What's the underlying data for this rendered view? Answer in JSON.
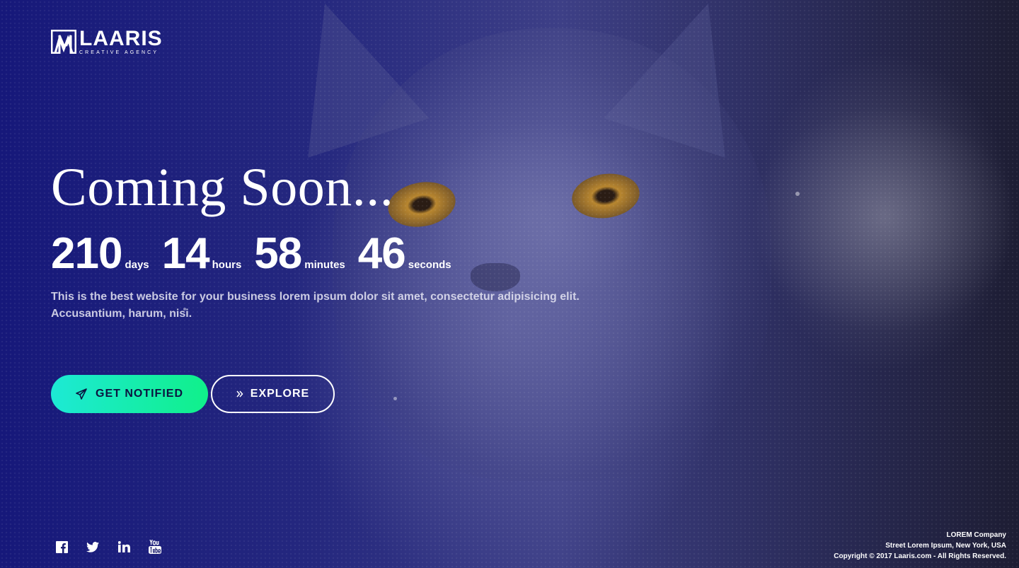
{
  "brand": {
    "name": "LAARIS",
    "tagline": "CREATIVE AGENCY",
    "accent_start": "#1de9d5",
    "accent_end": "#10f08a"
  },
  "hero": {
    "title": "Coming Soon...",
    "description_line1": "This is the best website for your business lorem ipsum dolor sit amet, consectetur adipisicing elit.",
    "description_line2": "Accusantium, harum, nisi."
  },
  "countdown": [
    {
      "value": "210",
      "label": "days"
    },
    {
      "value": "14",
      "label": "hours"
    },
    {
      "value": "58",
      "label": "minutes"
    },
    {
      "value": "46",
      "label": "seconds"
    }
  ],
  "buttons": {
    "notify": {
      "label": "GET NOTIFIED",
      "icon": "paper-plane-icon"
    },
    "explore": {
      "label": "EXPLORE",
      "icon": "double-chevron-right-icon"
    }
  },
  "socials": [
    {
      "name": "facebook",
      "icon": "facebook-icon"
    },
    {
      "name": "twitter",
      "icon": "twitter-icon"
    },
    {
      "name": "linkedin",
      "icon": "linkedin-icon"
    },
    {
      "name": "youtube",
      "icon": "youtube-icon"
    }
  ],
  "footer": {
    "company": "LOREM Company",
    "address": "Street Lorem Ipsum, New York, USA",
    "copyright": "Copyright © 2017 Laaris.com - All Rights Reserved."
  }
}
